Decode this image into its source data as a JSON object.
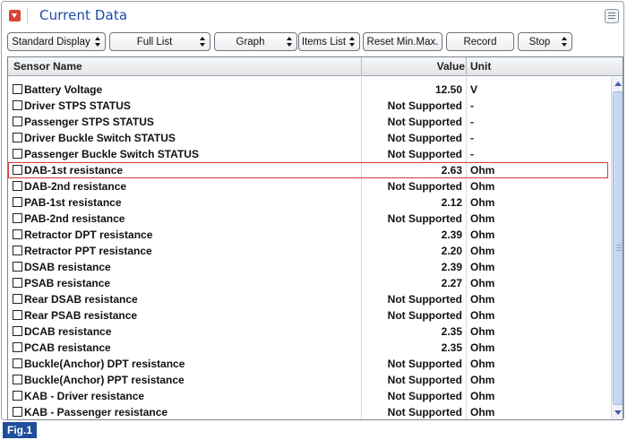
{
  "window": {
    "title": "Current Data",
    "menu_icon": "menu-icon"
  },
  "toolbar": {
    "standard_display": "Standard Display",
    "full_list": "Full List",
    "graph": "Graph",
    "items_list": "Items List",
    "reset_min_max": "Reset Min.Max.",
    "record": "Record",
    "stop": "Stop"
  },
  "table": {
    "headers": {
      "name": "Sensor Name",
      "value": "Value",
      "unit": "Unit"
    },
    "rows": [
      {
        "name": "Battery Voltage",
        "value": "12.50",
        "unit": "V"
      },
      {
        "name": "Driver STPS STATUS",
        "value": "Not Supported",
        "unit": "-"
      },
      {
        "name": "Passenger STPS STATUS",
        "value": "Not Supported",
        "unit": "-"
      },
      {
        "name": "Driver Buckle Switch STATUS",
        "value": "Not Supported",
        "unit": "-"
      },
      {
        "name": "Passenger Buckle Switch STATUS",
        "value": "Not Supported",
        "unit": "-"
      },
      {
        "name": "DAB-1st resistance",
        "value": "2.63",
        "unit": "Ohm",
        "selected": true
      },
      {
        "name": "DAB-2nd resistance",
        "value": "Not Supported",
        "unit": "Ohm"
      },
      {
        "name": "PAB-1st resistance",
        "value": "2.12",
        "unit": "Ohm"
      },
      {
        "name": "PAB-2nd resistance",
        "value": "Not Supported",
        "unit": "Ohm"
      },
      {
        "name": "Retractor DPT resistance",
        "value": "2.39",
        "unit": "Ohm"
      },
      {
        "name": "Retractor PPT resistance",
        "value": "2.20",
        "unit": "Ohm"
      },
      {
        "name": "DSAB resistance",
        "value": "2.39",
        "unit": "Ohm"
      },
      {
        "name": "PSAB resistance",
        "value": "2.27",
        "unit": "Ohm"
      },
      {
        "name": "Rear DSAB resistance",
        "value": "Not Supported",
        "unit": "Ohm"
      },
      {
        "name": "Rear PSAB resistance",
        "value": "Not Supported",
        "unit": "Ohm"
      },
      {
        "name": "DCAB resistance",
        "value": "2.35",
        "unit": "Ohm"
      },
      {
        "name": "PCAB resistance",
        "value": "2.35",
        "unit": "Ohm"
      },
      {
        "name": "Buckle(Anchor) DPT resistance",
        "value": "Not Supported",
        "unit": "Ohm"
      },
      {
        "name": "Buckle(Anchor) PPT resistance",
        "value": "Not Supported",
        "unit": "Ohm"
      },
      {
        "name": "KAB - Driver resistance",
        "value": "Not Supported",
        "unit": "Ohm"
      },
      {
        "name": "KAB - Passenger resistance",
        "value": "Not Supported",
        "unit": "Ohm"
      }
    ]
  },
  "figure_label": "Fig.1",
  "colors": {
    "accent": "#1d4aa8",
    "selection": "#d53a3a",
    "fig_bg": "#1f4f9b"
  }
}
